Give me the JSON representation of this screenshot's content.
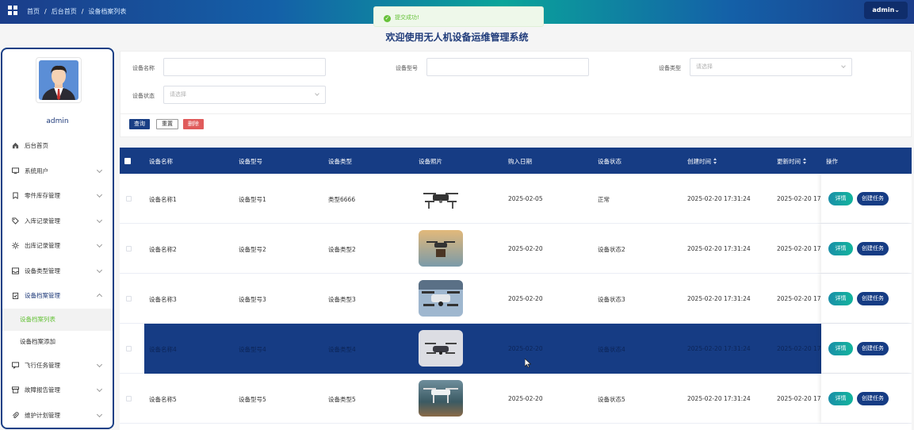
{
  "breadcrumb": [
    "首页",
    "后台首页",
    "设备档案列表"
  ],
  "header": {
    "user_label": "admin"
  },
  "toast": {
    "text": "提交成功!"
  },
  "system_title": "欢迎使用无人机设备运维管理系统",
  "sidebar": {
    "username": "admin",
    "items": [
      {
        "label": "后台首页",
        "icon": "home-icon"
      },
      {
        "label": "系统用户",
        "icon": "monitor-icon"
      },
      {
        "label": "零件库存管理",
        "icon": "bookmark-icon"
      },
      {
        "label": "入库记录管理",
        "icon": "tag-icon"
      },
      {
        "label": "出库记录管理",
        "icon": "sun-icon"
      },
      {
        "label": "设备类型管理",
        "icon": "inbox-icon"
      },
      {
        "label": "设备档案管理",
        "icon": "clipboard-icon"
      },
      {
        "label": "飞行任务管理",
        "icon": "chat-icon"
      },
      {
        "label": "故障报告管理",
        "icon": "box-icon"
      },
      {
        "label": "维护计划管理",
        "icon": "paperclip-icon"
      }
    ],
    "sub_items": [
      {
        "label": "设备档案列表",
        "active": true
      },
      {
        "label": "设备档案添加",
        "active": false
      }
    ]
  },
  "search": {
    "name_label": "设备名称",
    "model_label": "设备型号",
    "type_label": "设备类型",
    "type_placeholder": "请选择",
    "status_label": "设备状态",
    "status_placeholder": "请选择",
    "query_btn": "查询",
    "reset_btn": "重置",
    "delete_btn": "删除"
  },
  "table": {
    "columns": [
      "设备名称",
      "设备型号",
      "设备类型",
      "设备照片",
      "购入日期",
      "设备状态",
      "创建时间",
      "更新时间",
      "操作"
    ],
    "detail_btn": "详情",
    "task_btn": "创建任务",
    "rows": [
      {
        "name": "设备名称1",
        "model": "设备型号1",
        "type": "类型6666",
        "date": "2025-02-05",
        "status": "正常",
        "created": "2025-02-20 17:31:24",
        "updated": "2025-02-20 17"
      },
      {
        "name": "设备名称2",
        "model": "设备型号2",
        "type": "设备类型2",
        "date": "2025-02-20",
        "status": "设备状态2",
        "created": "2025-02-20 17:31:24",
        "updated": "2025-02-20 17"
      },
      {
        "name": "设备名称3",
        "model": "设备型号3",
        "type": "设备类型3",
        "date": "2025-02-20",
        "status": "设备状态3",
        "created": "2025-02-20 17:31:24",
        "updated": "2025-02-20 17"
      },
      {
        "name": "设备名称4",
        "model": "设备型号4",
        "type": "设备类型4",
        "date": "2025-02-20",
        "status": "设备状态4",
        "created": "2025-02-20 17:31:24",
        "updated": "2025-02-20 17"
      },
      {
        "name": "设备名称5",
        "model": "设备型号5",
        "type": "设备类型5",
        "date": "2025-02-20",
        "status": "设备状态5",
        "created": "2025-02-20 17:31:24",
        "updated": "2025-02-20 17"
      }
    ]
  },
  "colors": {
    "primary": "#163c84",
    "accent": "#13b59d",
    "success": "#67c23a",
    "danger": "#e05b5b"
  }
}
